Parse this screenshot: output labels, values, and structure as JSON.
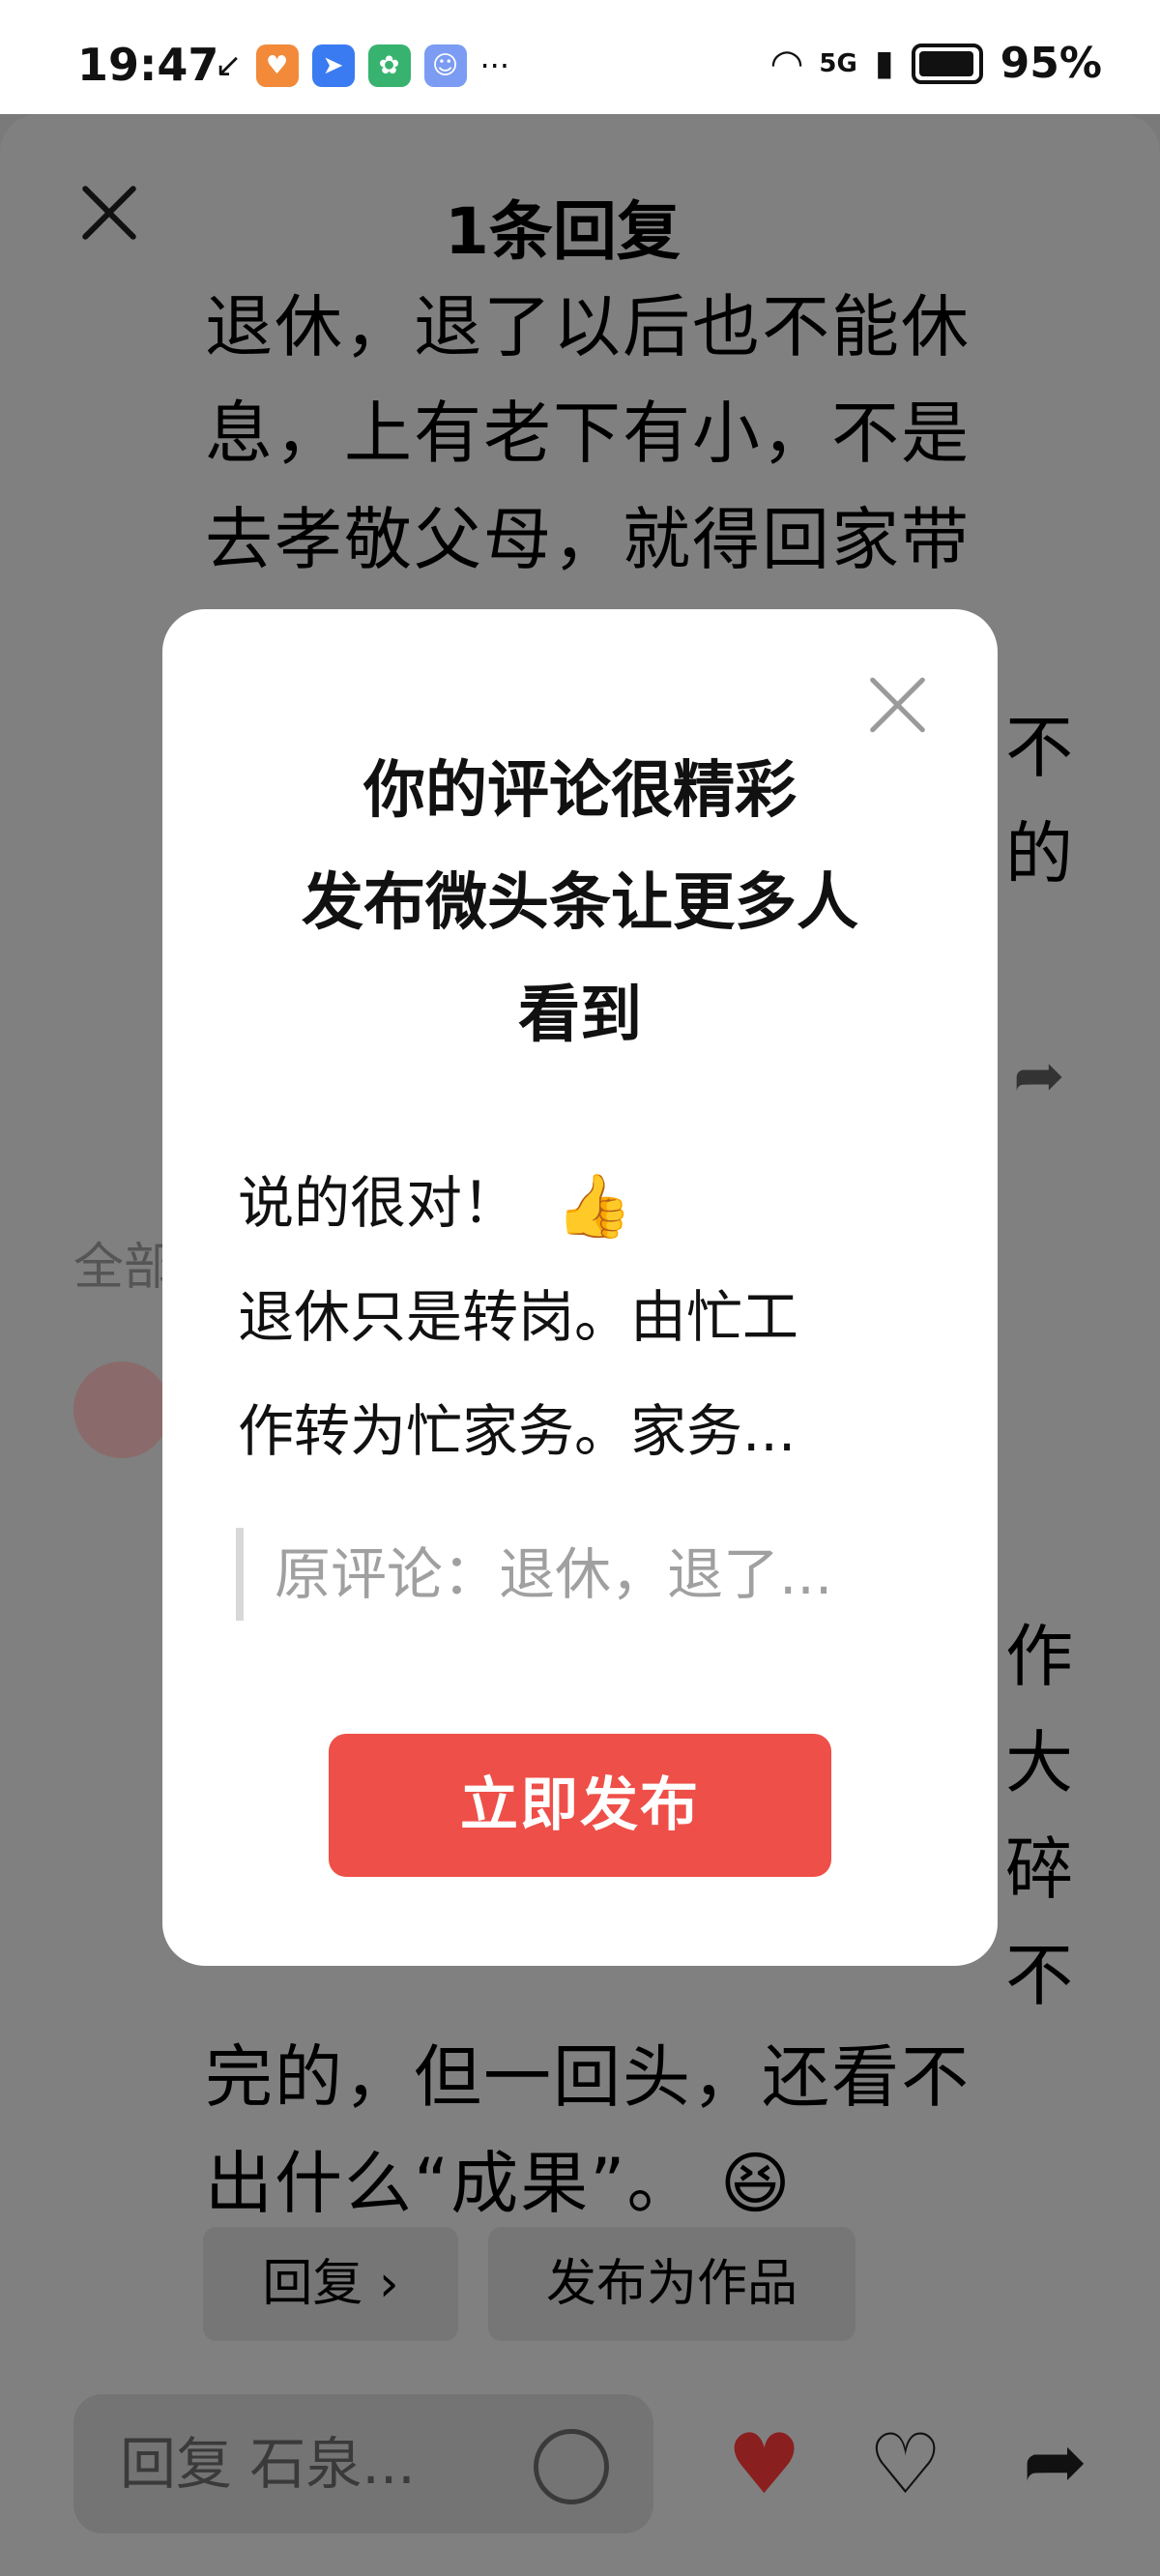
{
  "status_bar": {
    "time": "19:47",
    "more": "···",
    "network": "5G",
    "battery": "95%"
  },
  "sheet": {
    "title": "1条回复",
    "background_text": [
      "退休，退了以后也不能休",
      "息，上有老下有小，不是",
      "去孝敬父母，就得回家带"
    ],
    "right_edge_chars": [
      "不",
      "的",
      "作",
      "大",
      "碎",
      "不"
    ],
    "section_label": "全部",
    "tail_text": [
      "完的，但一回头，还看不",
      "出什么“成果”。"
    ],
    "tail_emoji": "😆",
    "reply_pill": "回复 ›",
    "publish_as_work_pill": "发布为作品",
    "reply_input_placeholder": "回复 石泉..."
  },
  "modal": {
    "title_lines": [
      "你的评论很精彩",
      "发布微头条让更多人",
      "看到"
    ],
    "comment_lines": [
      "说的很对！",
      "退休只是转岗。由忙工",
      "作转为忙家务。家务..."
    ],
    "thumb_emoji": "👍",
    "quote": "原评论：退休，退了...",
    "publish_button": "立即发布"
  },
  "colors": {
    "accent_red": "#ee4f48",
    "heart_red": "#8a1f1f"
  }
}
